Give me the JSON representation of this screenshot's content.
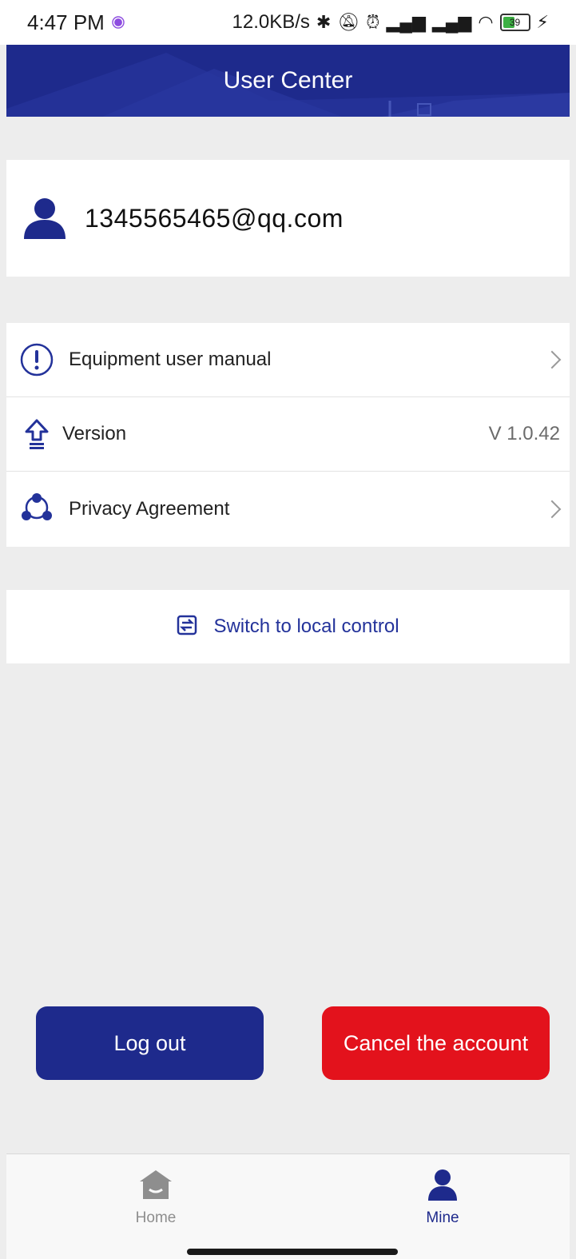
{
  "status_bar": {
    "time": "4:47 PM",
    "network_speed": "12.0KB/s",
    "battery_level": "39"
  },
  "header": {
    "title": "User Center"
  },
  "user": {
    "email": "1345565465@qq.com"
  },
  "menu": {
    "items": [
      {
        "label": "Equipment user manual",
        "icon": "info-circle-icon"
      },
      {
        "label": "Version",
        "value": "V 1.0.42",
        "icon": "upgrade-arrow-icon"
      },
      {
        "label": "Privacy Agreement",
        "icon": "share-nodes-icon"
      }
    ]
  },
  "switch": {
    "label": "Switch to local control",
    "icon": "swap-icon"
  },
  "buttons": {
    "logout": "Log out",
    "cancel_account": "Cancel the account"
  },
  "tabbar": {
    "home": "Home",
    "mine": "Mine"
  },
  "colors": {
    "primary": "#1e2a8c",
    "danger": "#e3121c",
    "background": "#ededed"
  }
}
